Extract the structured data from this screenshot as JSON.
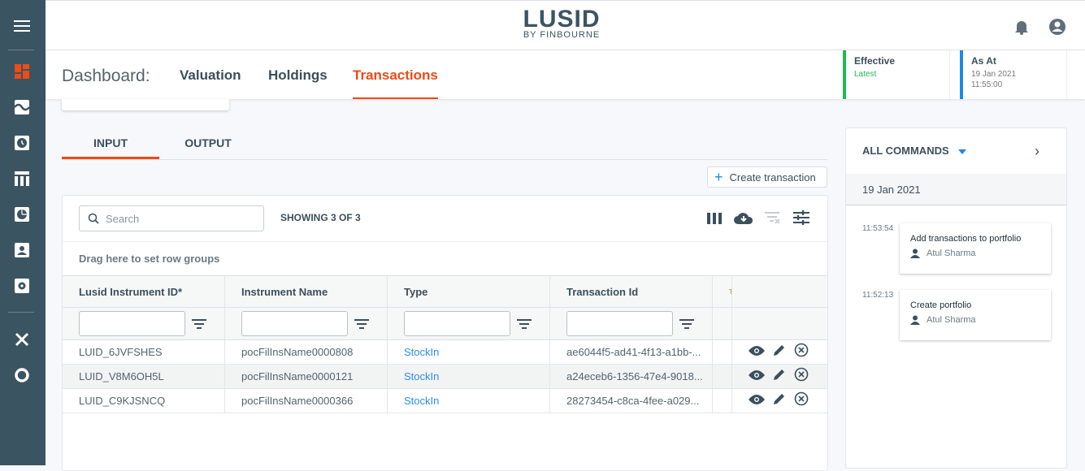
{
  "app": {
    "logo": "LUSID",
    "logo_sub": "BY FINBOURNE"
  },
  "sidebar": {
    "items": [
      "menu",
      "dashboard",
      "charts",
      "history",
      "table",
      "pie",
      "contacts",
      "settings",
      "tools",
      "support"
    ]
  },
  "nav": {
    "prefix": "Dashboard:",
    "tabs": [
      "Valuation",
      "Holdings",
      "Transactions"
    ],
    "active": "Transactions"
  },
  "effective": {
    "label": "Effective",
    "value": "Latest"
  },
  "as_at": {
    "label": "As At",
    "date": "19 Jan 2021",
    "time": "11:55:00"
  },
  "tabs": {
    "input": "INPUT",
    "output": "OUTPUT"
  },
  "create_button": "Create transaction",
  "grid": {
    "search_placeholder": "Search",
    "showing": "SHOWING 3 OF 3",
    "group_hint": "Drag here to set row groups",
    "columns": [
      "Lusid Instrument ID*",
      "Instrument Name",
      "Type",
      "Transaction Id",
      "T"
    ],
    "rows": [
      {
        "id": "LUID_6JVFSHES",
        "name": "pocFilInsName0000808",
        "type": "StockIn",
        "txn": "ae6044f5-ad41-4f13-a1bb-..."
      },
      {
        "id": "LUID_V8M6OH5L",
        "name": "pocFilInsName0000121",
        "type": "StockIn",
        "txn": "a24eceb6-1356-47e4-9018..."
      },
      {
        "id": "LUID_C9KJSNCQ",
        "name": "pocFilInsName0000366",
        "type": "StockIn",
        "txn": "28273454-c8ca-4fee-a029..."
      }
    ]
  },
  "commands": {
    "title": "ALL COMMANDS",
    "date": "19 Jan 2021",
    "items": [
      {
        "time": "11:53:54",
        "title": "Add transactions to portfolio",
        "user": "Atul Sharma"
      },
      {
        "time": "11:52:13",
        "title": "Create portfolio",
        "user": "Atul Sharma"
      }
    ]
  },
  "colors": {
    "accent": "#f04a15",
    "sidebar": "#3b5462",
    "link": "#2d8ee8",
    "effective": "#1db954",
    "as_at": "#1e88e5"
  }
}
